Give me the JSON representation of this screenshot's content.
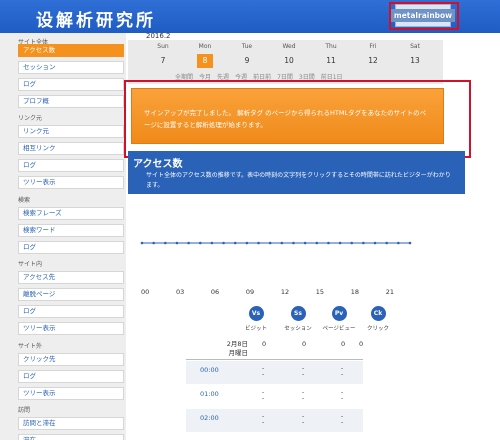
{
  "header": {
    "logo": "设解析研究所",
    "user_button": "metalrainbow"
  },
  "sidebar": {
    "groups": [
      "サイト全体",
      "リンク元",
      "検索",
      "サイト内",
      "サイト外",
      "訪問"
    ],
    "items": [
      "アクセス数",
      "セッション",
      "ログ",
      "プロフ概",
      "リンク元",
      "相互リンク",
      "ログ",
      "ツリー表示",
      "検索フレーズ",
      "検索ワード",
      "ログ",
      "アクセス先",
      "離脱ページ",
      "ログ",
      "ツリー表示",
      "クリック先",
      "ログ",
      "ツリー表示",
      "訪問と滞在",
      "滞在"
    ]
  },
  "calendar": {
    "month": "2016.2",
    "days": [
      {
        "dow": "Sun",
        "date": "7"
      },
      {
        "dow": "Mon",
        "date": "8"
      },
      {
        "dow": "Tue",
        "date": "9"
      },
      {
        "dow": "Wed",
        "date": "10"
      },
      {
        "dow": "Thu",
        "date": "11"
      },
      {
        "dow": "Fri",
        "date": "12"
      },
      {
        "dow": "Sat",
        "date": "13"
      }
    ],
    "selected_index": 1,
    "periods": [
      "全期間",
      "今月",
      "先週",
      "今週",
      "前日前",
      "7日間",
      "3日間",
      "前日1日"
    ]
  },
  "notice": {
    "text": "サインアップが完了しました。 解析タグ のページから得られるHTMLタグをあなたのサイトのページに設置すると解析処理が始まります。"
  },
  "access": {
    "title": "アクセス数",
    "desc": "サイト全体のアクセス数の推移です。表中の時刻の文字列をクリックするとその時間帯に訪れたビジターがわかります。"
  },
  "chart_data": {
    "type": "line",
    "x": [
      "00",
      "01",
      "02",
      "03",
      "04",
      "05",
      "06",
      "07",
      "08",
      "09",
      "10",
      "11",
      "12",
      "13",
      "14",
      "15",
      "16",
      "17",
      "18",
      "19",
      "20",
      "21",
      "22",
      "23"
    ],
    "series": [
      {
        "values": [
          0,
          0,
          0,
          0,
          0,
          0,
          0,
          0,
          0,
          0,
          0,
          0,
          0,
          0,
          0,
          0,
          0,
          0,
          0,
          0,
          0,
          0,
          0,
          0
        ]
      }
    ],
    "tick_labels": [
      "00",
      "03",
      "06",
      "09",
      "12",
      "15",
      "18",
      "21"
    ]
  },
  "metrics": [
    {
      "abbr": "Vs",
      "label": "ビジット"
    },
    {
      "abbr": "Ss",
      "label": "セッション"
    },
    {
      "abbr": "Pv",
      "label": "ページビュー"
    },
    {
      "abbr": "Ck",
      "label": "クリック"
    }
  ],
  "table": {
    "date": "2月8日",
    "weekday": "月曜日",
    "totals": [
      "0",
      "0",
      "0",
      "0"
    ],
    "rows": [
      "00:00",
      "01:00",
      "02:00"
    ],
    "dash": "-"
  },
  "colors": {
    "brand": "#2a62b7",
    "accent": "#f5921e",
    "highlight": "#d0112a"
  }
}
